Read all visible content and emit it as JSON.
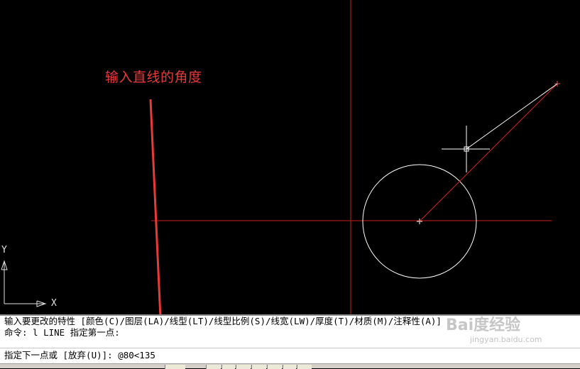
{
  "annotation": {
    "text": "输入直线的角度",
    "color": "#e83a3a"
  },
  "ucs": {
    "x_label": "X",
    "y_label": "Y"
  },
  "colors": {
    "crosshair": "#c81e1e",
    "line_red": "#d42222",
    "geometry": "#ffffff",
    "arrow": "#e83a3a",
    "background": "#000000"
  },
  "command": {
    "history": [
      "输入要更改的特性 [颜色(C)/图层(LA)/线型(LT)/线型比例(S)/线宽(LW)/厚度(T)/材质(M)/注释性(A)]",
      "命令: l LINE 指定第一点:"
    ],
    "prompt": "指定下一点或 [放弃(U)]: @80<135"
  },
  "watermark": {
    "logo": "Bai度经验",
    "site": "jingyan.baidu.com"
  }
}
